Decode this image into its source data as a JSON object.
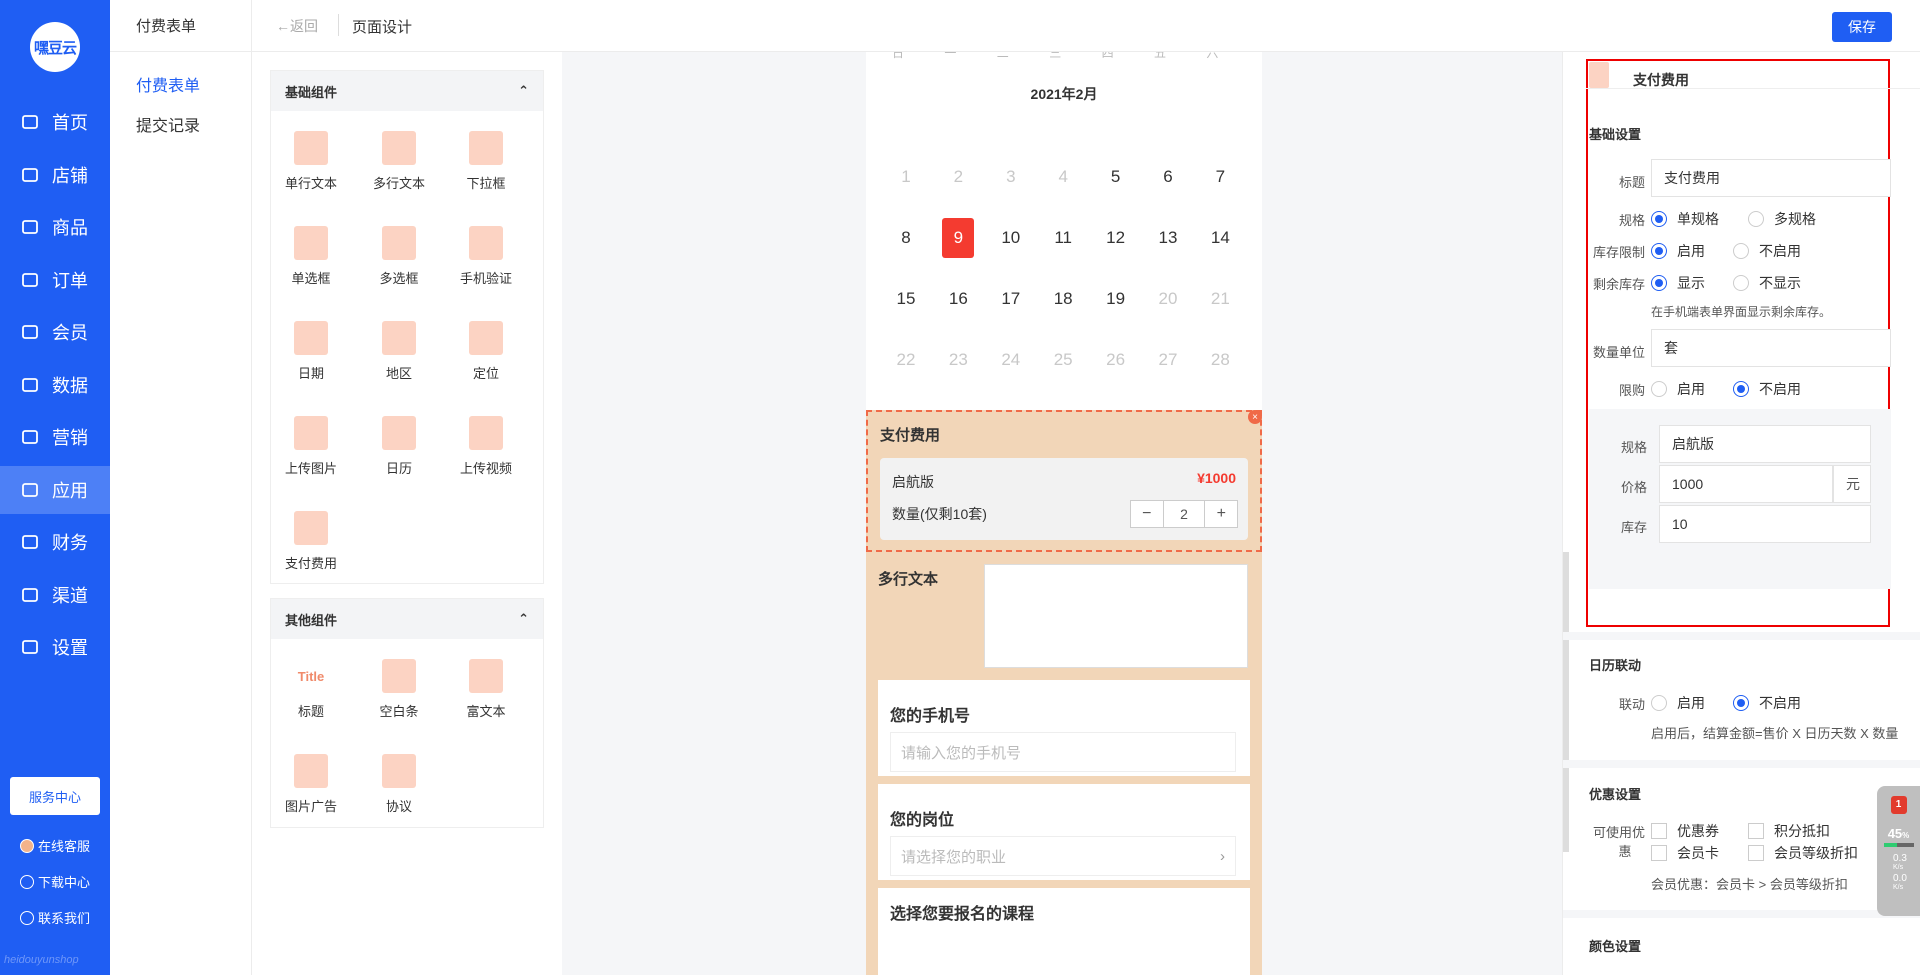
{
  "nav": {
    "logo": "嘿豆云",
    "items": [
      {
        "label": "首页",
        "icon": "home-icon"
      },
      {
        "label": "店铺",
        "icon": "store-icon"
      },
      {
        "label": "商品",
        "icon": "goods-icon"
      },
      {
        "label": "订单",
        "icon": "order-icon"
      },
      {
        "label": "会员",
        "icon": "member-icon"
      },
      {
        "label": "数据",
        "icon": "chart-icon"
      },
      {
        "label": "营销",
        "icon": "tag-icon"
      },
      {
        "label": "应用",
        "icon": "app-icon"
      },
      {
        "label": "财务",
        "icon": "finance-icon"
      },
      {
        "label": "渠道",
        "icon": "channel-icon"
      },
      {
        "label": "设置",
        "icon": "gear-icon"
      }
    ],
    "active_index": 7,
    "service_center": "服务中心",
    "links": [
      "在线客服",
      "下载中心",
      "联系我们"
    ],
    "footer": "heidouyunshop"
  },
  "sub": {
    "title": "付费表单",
    "items": [
      "付费表单",
      "提交记录"
    ]
  },
  "topbar": {
    "back": "返回",
    "title": "页面设计",
    "save": "保存"
  },
  "palette": {
    "basic": {
      "title": "基础组件",
      "items": [
        "单行文本",
        "多行文本",
        "下拉框",
        "单选框",
        "多选框",
        "手机验证",
        "日期",
        "地区",
        "定位",
        "上传图片",
        "日历",
        "上传视频",
        "支付费用"
      ]
    },
    "other": {
      "title": "其他组件",
      "items": [
        "标题",
        "空白条",
        "富文本",
        "图片广告",
        "协议"
      ]
    },
    "title_icon_text": "Title"
  },
  "calendar": {
    "month": "2021年2月",
    "weekdays": [
      "日",
      "一",
      "二",
      "三",
      "四",
      "五",
      "六"
    ],
    "weeks": [
      [
        {
          "d": "1",
          "m": true
        },
        {
          "d": "2",
          "m": true
        },
        {
          "d": "3",
          "m": true
        },
        {
          "d": "4",
          "m": true
        },
        {
          "d": "5"
        },
        {
          "d": "6"
        },
        {
          "d": "7"
        }
      ],
      [
        {
          "d": "8"
        },
        {
          "d": "9",
          "sel": true
        },
        {
          "d": "10"
        },
        {
          "d": "11"
        },
        {
          "d": "12"
        },
        {
          "d": "13"
        },
        {
          "d": "14"
        }
      ],
      [
        {
          "d": "15"
        },
        {
          "d": "16"
        },
        {
          "d": "17"
        },
        {
          "d": "18"
        },
        {
          "d": "19"
        },
        {
          "d": "20",
          "m": true
        },
        {
          "d": "21",
          "m": true
        }
      ],
      [
        {
          "d": "22",
          "m": true
        },
        {
          "d": "23",
          "m": true
        },
        {
          "d": "24",
          "m": true
        },
        {
          "d": "25",
          "m": true
        },
        {
          "d": "26",
          "m": true
        },
        {
          "d": "27",
          "m": true
        },
        {
          "d": "28",
          "m": true
        }
      ]
    ]
  },
  "pay": {
    "title": "支付费用",
    "spec": "启航版",
    "price": "¥1000",
    "qty_label": "数量(仅剩10套)",
    "qty": "2",
    "minus": "−",
    "plus": "+",
    "close": "×"
  },
  "form": {
    "multiline_title": "多行文本",
    "phone_title": "您的手机号",
    "phone_placeholder": "请输入您的手机号",
    "job_title": "您的岗位",
    "job_placeholder": "请选择您的职业",
    "course_title": "选择您要报名的课程"
  },
  "props": {
    "header": "支付费用",
    "basic_section": "基础设置",
    "title_label": "标题",
    "title_value": "支付费用",
    "spec_label": "规格",
    "spec_single": "单规格",
    "spec_multi": "多规格",
    "stock_limit_label": "库存限制",
    "enable": "启用",
    "disable": "不启用",
    "remain_label": "剩余库存",
    "show": "显示",
    "hide": "不显示",
    "remain_hint": "在手机端表单界面显示剩余库存。",
    "unit_label": "数量单位",
    "unit_value": "套",
    "limit_label": "限购",
    "sku_spec_label": "规格",
    "sku_spec_value": "启航版",
    "price_label": "价格",
    "price_value": "1000",
    "price_unit": "元",
    "stock_label": "库存",
    "stock_value": "10",
    "calendar_section": "日历联动",
    "link_label": "联动",
    "calendar_hint": "启用后，结算金额=售价 X 日历天数 X 数量",
    "discount_section": "优惠设置",
    "discount_label_1": "可使用优",
    "discount_label_2": "惠",
    "coupon": "优惠券",
    "points": "积分抵扣",
    "member_card": "会员卡",
    "member_level": "会员等级折扣",
    "discount_hint": "会员优惠：会员卡 > 会员等级折扣",
    "color_section": "颜色设置"
  },
  "widget": {
    "badge": "1",
    "percent": "45",
    "percent_unit": "%",
    "up": "0.3",
    "down": "0.0",
    "unit": "K/s"
  }
}
